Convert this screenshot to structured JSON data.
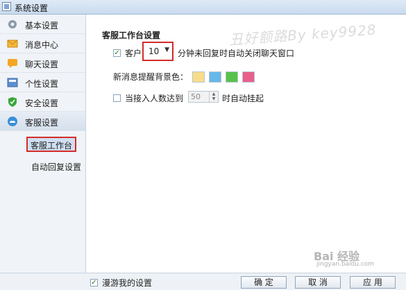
{
  "window": {
    "title": "系统设置"
  },
  "sidebar": {
    "items": [
      {
        "label": "基本设置",
        "icon": "gear-icon"
      },
      {
        "label": "消息中心",
        "icon": "envelope-icon"
      },
      {
        "label": "聊天设置",
        "icon": "chat-bubble-icon"
      },
      {
        "label": "个性设置",
        "icon": "profile-card-icon"
      },
      {
        "label": "安全设置",
        "icon": "shield-icon"
      },
      {
        "label": "客服设置",
        "icon": "cloud-icon"
      }
    ],
    "sub_items": [
      {
        "label": "客服工作台"
      },
      {
        "label": "自动回复设置"
      }
    ]
  },
  "main": {
    "section_title": "客服工作台设置",
    "auto_close": {
      "prefix": "客户",
      "minutes": "10",
      "suffix": "分钟未回复时自动关闭聊天窗口",
      "checked": true
    },
    "bg_color": {
      "label": "新消息提醒背景色：",
      "swatches": [
        "#f7dd8a",
        "#66b8ea",
        "#58c24a",
        "#e95f8c"
      ]
    },
    "auto_hangup": {
      "prefix": "当接入人数达到",
      "value": "50",
      "suffix": "时自动挂起",
      "checked": false
    }
  },
  "watermark": "丑好额路By key9928",
  "footer": {
    "roam_label": "漫游我的设置",
    "roam_checked": true,
    "ok": "确 定",
    "cancel": "取 消",
    "apply": "应 用"
  },
  "baidu_watermark": {
    "brand": "Bai 经验",
    "url": "jingyan.baidu.com"
  }
}
